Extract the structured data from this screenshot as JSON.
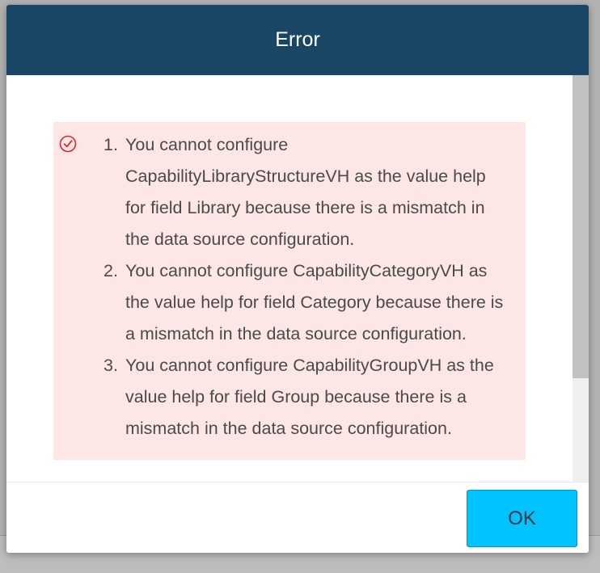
{
  "dialog": {
    "title": "Error",
    "icon": "check-circle-icon",
    "accent_color": "#184664",
    "message_background": "#fce6e6",
    "icon_color": "#e0262c",
    "messages": [
      {
        "number": "1.",
        "text": "You cannot configure CapabilityLibraryStructureVH as the value help for field Library because there is a mismatch in the data source configuration."
      },
      {
        "number": "2.",
        "text": "You cannot configure CapabilityCategoryVH as the value help for field Category because there is a mismatch in the data source configuration."
      },
      {
        "number": "3.",
        "text": "You cannot configure CapabilityGroupVH as the value help for field Group because there is a mismatch in the data source configuration."
      }
    ],
    "ok_label": "OK",
    "ok_color": "#00c3ff"
  }
}
